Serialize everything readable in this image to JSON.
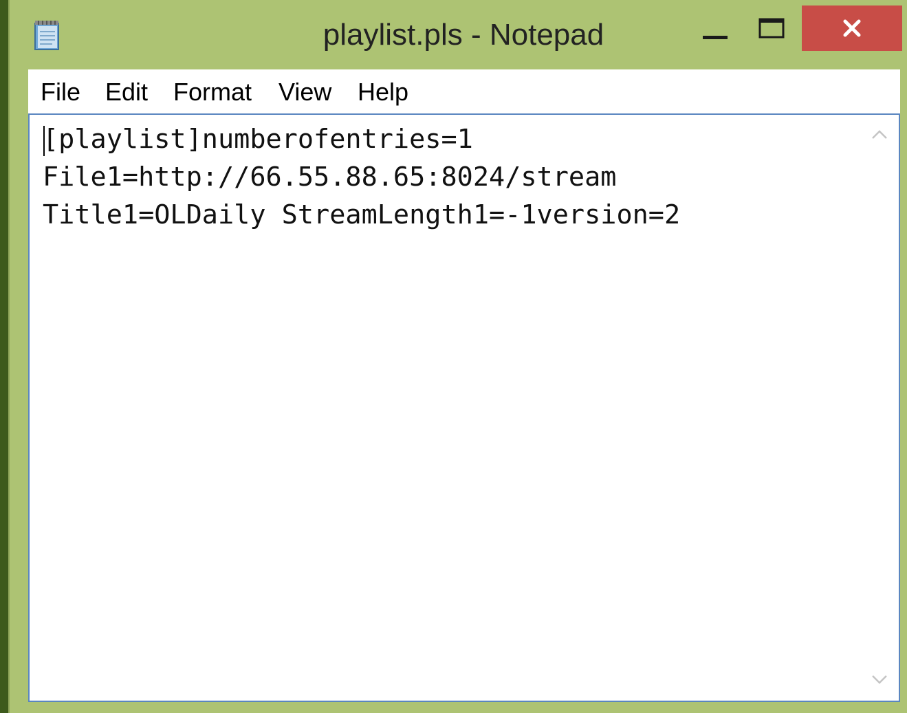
{
  "window": {
    "title": "playlist.pls - Notepad",
    "frame_color": "#adc373",
    "close_color": "#c84d47"
  },
  "titlebar": {
    "icon": "notepad-icon",
    "buttons": {
      "minimize": "minimize-icon",
      "maximize": "maximize-icon",
      "close": "close-icon"
    }
  },
  "menu": {
    "items": [
      "File",
      "Edit",
      "Format",
      "View",
      "Help"
    ]
  },
  "editor": {
    "content": "[playlist]numberofentries=1\nFile1=http://66.55.88.65:8024/stream\nTitle1=OLDaily StreamLength1=-1version=2",
    "selection_color": "#5a86c0"
  },
  "scrollbar": {
    "up_icon": "chevron-up-icon",
    "down_icon": "chevron-down-icon"
  }
}
